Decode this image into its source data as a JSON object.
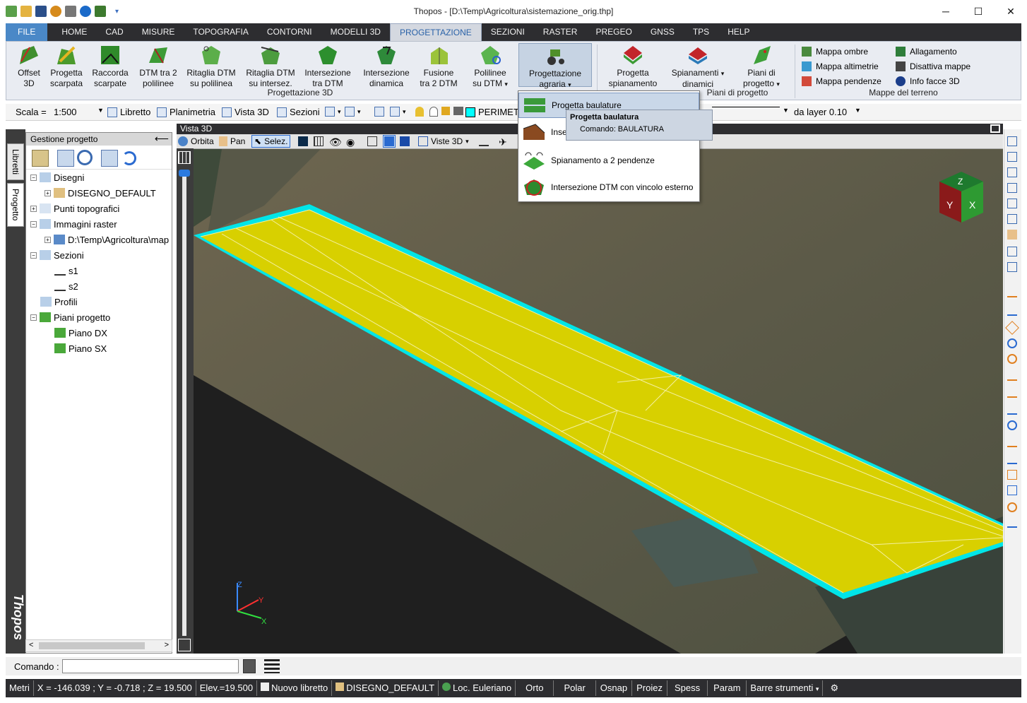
{
  "window": {
    "title": "Thopos - [D:\\Temp\\Agricoltura\\sistemazione_orig.thp]",
    "minimize": "─",
    "maximize": "☐",
    "close": "✕"
  },
  "ribbon_tabs": [
    "FILE",
    "HOME",
    "CAD",
    "MISURE",
    "TOPOGRAFIA",
    "CONTORNI",
    "MODELLI 3D",
    "PROGETTAZIONE",
    "SEZIONI",
    "RASTER",
    "PREGEO",
    "GNSS",
    "TPS",
    "HELP"
  ],
  "ribbon": {
    "buttons": [
      {
        "l1": "Offset",
        "l2": "3D"
      },
      {
        "l1": "Progetta",
        "l2": "scarpata"
      },
      {
        "l1": "Raccorda",
        "l2": "scarpate"
      },
      {
        "l1": "DTM tra 2",
        "l2": "polilinee"
      },
      {
        "l1": "Ritaglia DTM",
        "l2": "su polilinea"
      },
      {
        "l1": "Ritaglia DTM",
        "l2": "su intersez."
      },
      {
        "l1": "Intersezione",
        "l2": "tra DTM"
      },
      {
        "l1": "Intersezione",
        "l2": "dinamica"
      },
      {
        "l1": "Fusione",
        "l2": "tra 2 DTM"
      },
      {
        "l1": "Polilinee",
        "l2": "su DTM"
      },
      {
        "l1": "Progettazione",
        "l2": "agraria"
      },
      {
        "l1": "Progetta",
        "l2": "spianamento"
      },
      {
        "l1": "Spianamenti",
        "l2": "dinamici"
      },
      {
        "l1": "Piani di",
        "l2": "progetto"
      }
    ],
    "group1": "Progettazione 3D",
    "group2": "Piani di progetto",
    "group3": "Mappe del terreno",
    "maps": [
      "Mappa ombre",
      "Mappa altimetrie",
      "Mappa pendenze",
      "Allagamento",
      "Disattiva mappe",
      "Info facce 3D"
    ]
  },
  "toolbar": {
    "scala_label": "Scala =",
    "scala_value": "1:500",
    "libretto": "Libretto",
    "planimetria": "Planimetria",
    "vista3d": "Vista 3D",
    "sezioni": "Sezioni",
    "layer": "PERIMETRO",
    "da_layer": "da layer 0.10"
  },
  "side_tabs": [
    "Libretti",
    "Progetto"
  ],
  "logo": "Thopos",
  "panel": {
    "title": "Gestione progetto",
    "tree": [
      {
        "label": "Disegni",
        "level": 0,
        "exp": "−"
      },
      {
        "label": "DISEGNO_DEFAULT",
        "level": 1,
        "exp": "+"
      },
      {
        "label": "Punti topografici",
        "level": 0,
        "exp": "+"
      },
      {
        "label": "Immagini raster",
        "level": 0,
        "exp": "−"
      },
      {
        "label": "D:\\Temp\\Agricoltura\\map",
        "level": 1,
        "exp": "+"
      },
      {
        "label": "Sezioni",
        "level": 0,
        "exp": "−"
      },
      {
        "label": "s1",
        "level": 1,
        "exp": ""
      },
      {
        "label": "s2",
        "level": 1,
        "exp": ""
      },
      {
        "label": "Profili",
        "level": 0,
        "exp": ""
      },
      {
        "label": "Piani progetto",
        "level": 0,
        "exp": "−"
      },
      {
        "label": "Piano DX",
        "level": 1,
        "exp": ""
      },
      {
        "label": "Piano SX",
        "level": 1,
        "exp": ""
      }
    ]
  },
  "view3d": {
    "title": "Vista 3D",
    "orbita": "Orbita",
    "pan": "Pan",
    "selez": "Selez.",
    "viste": "Viste 3D",
    "axes": {
      "x": "X",
      "y": "Y",
      "z": "Z"
    }
  },
  "dropdown": {
    "items": [
      "Progetta baulature",
      "Inse",
      "Spianamento a 2 pendenze",
      "Intersezione DTM con vincolo esterno"
    ]
  },
  "tooltip": {
    "title": "Progetta baulatura",
    "command": "Comando: BAULATURA"
  },
  "command": {
    "label": "Comando :",
    "value": ""
  },
  "status": {
    "units": "Metri",
    "coords": "X = -146.039 ; Y = -0.718 ; Z = 19.500",
    "elev": "Elev.=19.500",
    "nuovo_libretto": "Nuovo libretto",
    "disegno": "DISEGNO_DEFAULT",
    "loc": "Loc. Euleriano",
    "orto": "Orto",
    "polar": "Polar",
    "osnap": "Osnap",
    "proiez": "Proiez",
    "spess": "Spess",
    "param": "Param",
    "barre": "Barre strumenti"
  }
}
